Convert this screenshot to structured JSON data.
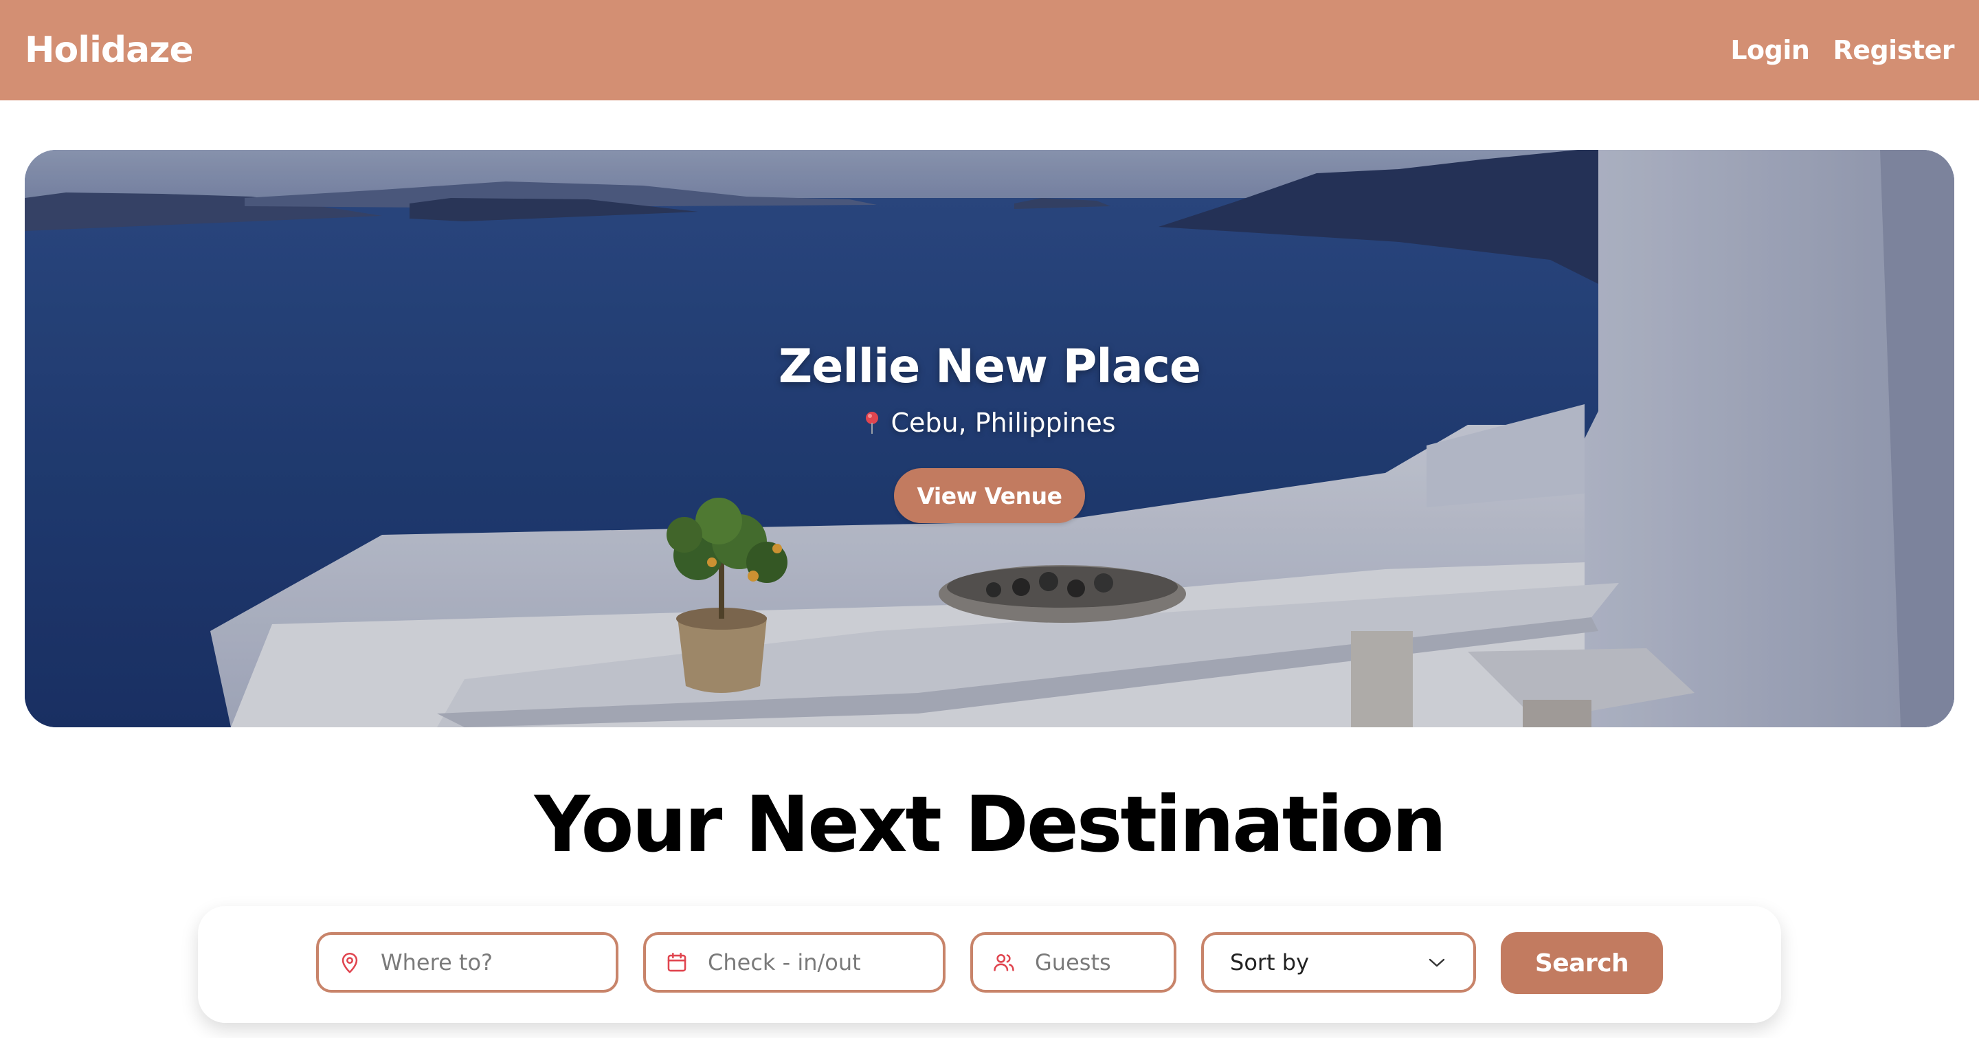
{
  "header": {
    "brand": "Holidaze",
    "nav": {
      "login": "Login",
      "register": "Register"
    }
  },
  "hero": {
    "venue_name": "Zellie New Place",
    "location": "Cebu, Philippines",
    "location_icon": "map-pin-icon",
    "cta_label": "View Venue"
  },
  "destination": {
    "title": "Your Next Destination"
  },
  "search": {
    "where": {
      "placeholder": "Where to?",
      "icon": "map-pin-icon"
    },
    "dates": {
      "placeholder": "Check - in/out",
      "icon": "calendar-icon"
    },
    "guests": {
      "placeholder": "Guests",
      "icon": "users-icon"
    },
    "sort": {
      "label": "Sort by",
      "icon": "chevron-down-icon"
    },
    "button_label": "Search"
  },
  "colors": {
    "header_bg": "#d38f73",
    "accent": "#c27b60",
    "field_border": "#c8846a"
  }
}
